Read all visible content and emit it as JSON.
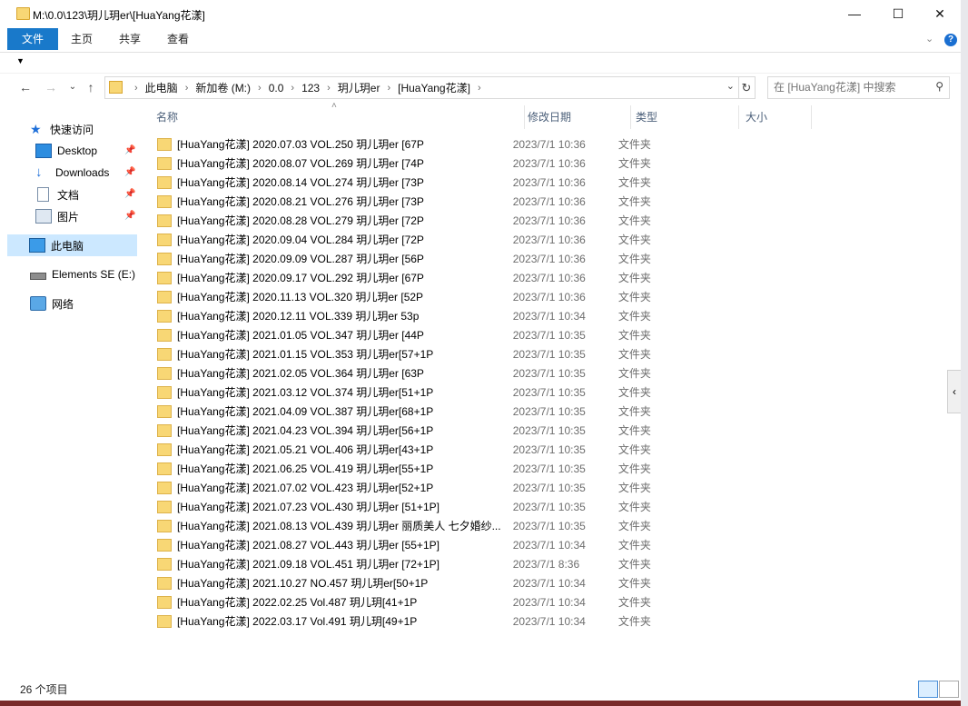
{
  "window": {
    "title": "M:\\0.0\\123\\玥儿玥er\\[HuaYang花漾]"
  },
  "ribbon": {
    "tabs": [
      "文件",
      "主页",
      "共享",
      "查看"
    ]
  },
  "address": {
    "crumbs": [
      "此电脑",
      "新加卷 (M:)",
      "0.0",
      "123",
      "玥儿玥er",
      "[HuaYang花漾]"
    ],
    "search_placeholder": "在 [HuaYang花漾] 中搜索"
  },
  "sidebar": {
    "items": [
      {
        "label": "快速访问",
        "icon": "star-icon"
      },
      {
        "label": "Desktop",
        "icon": "desktop-icon"
      },
      {
        "label": "Downloads",
        "icon": "download-icon"
      },
      {
        "label": "文档",
        "icon": "document-icon"
      },
      {
        "label": "图片",
        "icon": "picture-icon"
      },
      {
        "label": "此电脑",
        "icon": "computer-icon"
      },
      {
        "label": "Elements SE (E:)",
        "icon": "drive-icon"
      },
      {
        "label": "网络",
        "icon": "network-icon"
      }
    ]
  },
  "columns": {
    "name": "名称",
    "date": "修改日期",
    "type": "类型",
    "size": "大小"
  },
  "files": [
    {
      "name": "[HuaYang花漾] 2020.07.03 VOL.250 玥儿玥er [67P",
      "date": "2023/7/1 10:36",
      "type": "文件夹"
    },
    {
      "name": "[HuaYang花漾] 2020.08.07 VOL.269 玥儿玥er [74P",
      "date": "2023/7/1 10:36",
      "type": "文件夹"
    },
    {
      "name": "[HuaYang花漾] 2020.08.14 VOL.274 玥儿玥er [73P",
      "date": "2023/7/1 10:36",
      "type": "文件夹"
    },
    {
      "name": "[HuaYang花漾] 2020.08.21 VOL.276 玥儿玥er [73P",
      "date": "2023/7/1 10:36",
      "type": "文件夹"
    },
    {
      "name": "[HuaYang花漾] 2020.08.28 VOL.279 玥儿玥er [72P",
      "date": "2023/7/1 10:36",
      "type": "文件夹"
    },
    {
      "name": "[HuaYang花漾] 2020.09.04 VOL.284 玥儿玥er [72P",
      "date": "2023/7/1 10:36",
      "type": "文件夹"
    },
    {
      "name": "[HuaYang花漾] 2020.09.09 VOL.287 玥儿玥er [56P",
      "date": "2023/7/1 10:36",
      "type": "文件夹"
    },
    {
      "name": "[HuaYang花漾] 2020.09.17 VOL.292 玥儿玥er [67P",
      "date": "2023/7/1 10:36",
      "type": "文件夹"
    },
    {
      "name": "[HuaYang花漾] 2020.11.13 VOL.320 玥儿玥er [52P",
      "date": "2023/7/1 10:36",
      "type": "文件夹"
    },
    {
      "name": "[HuaYang花漾] 2020.12.11 VOL.339 玥儿玥er 53p",
      "date": "2023/7/1 10:34",
      "type": "文件夹"
    },
    {
      "name": "[HuaYang花漾] 2021.01.05 VOL.347 玥儿玥er [44P",
      "date": "2023/7/1 10:35",
      "type": "文件夹"
    },
    {
      "name": "[HuaYang花漾] 2021.01.15 VOL.353 玥儿玥er[57+1P",
      "date": "2023/7/1 10:35",
      "type": "文件夹"
    },
    {
      "name": "[HuaYang花漾] 2021.02.05 VOL.364 玥儿玥er [63P",
      "date": "2023/7/1 10:35",
      "type": "文件夹"
    },
    {
      "name": "[HuaYang花漾] 2021.03.12 VOL.374 玥儿玥er[51+1P",
      "date": "2023/7/1 10:35",
      "type": "文件夹"
    },
    {
      "name": "[HuaYang花漾] 2021.04.09 VOL.387 玥儿玥er[68+1P",
      "date": "2023/7/1 10:35",
      "type": "文件夹"
    },
    {
      "name": "[HuaYang花漾] 2021.04.23 VOL.394 玥儿玥er[56+1P",
      "date": "2023/7/1 10:35",
      "type": "文件夹"
    },
    {
      "name": "[HuaYang花漾] 2021.05.21 VOL.406 玥儿玥er[43+1P",
      "date": "2023/7/1 10:35",
      "type": "文件夹"
    },
    {
      "name": "[HuaYang花漾] 2021.06.25 VOL.419 玥儿玥er[55+1P",
      "date": "2023/7/1 10:35",
      "type": "文件夹"
    },
    {
      "name": "[HuaYang花漾] 2021.07.02 VOL.423 玥儿玥er[52+1P",
      "date": "2023/7/1 10:35",
      "type": "文件夹"
    },
    {
      "name": "[HuaYang花漾] 2021.07.23 VOL.430 玥儿玥er [51+1P]",
      "date": "2023/7/1 10:35",
      "type": "文件夹"
    },
    {
      "name": "[HuaYang花漾] 2021.08.13 VOL.439 玥儿玥er 丽质美人 七夕婚纱...",
      "date": "2023/7/1 10:35",
      "type": "文件夹"
    },
    {
      "name": "[HuaYang花漾] 2021.08.27 VOL.443 玥儿玥er [55+1P]",
      "date": "2023/7/1 10:34",
      "type": "文件夹"
    },
    {
      "name": "[HuaYang花漾] 2021.09.18 VOL.451 玥儿玥er [72+1P]",
      "date": "2023/7/1 8:36",
      "type": "文件夹"
    },
    {
      "name": "[HuaYang花漾] 2021.10.27 NO.457 玥儿玥er[50+1P",
      "date": "2023/7/1 10:34",
      "type": "文件夹"
    },
    {
      "name": "[HuaYang花漾] 2022.02.25 Vol.487 玥儿玥[41+1P",
      "date": "2023/7/1 10:34",
      "type": "文件夹"
    },
    {
      "name": "[HuaYang花漾] 2022.03.17 Vol.491 玥儿玥[49+1P",
      "date": "2023/7/1 10:34",
      "type": "文件夹"
    }
  ],
  "status": {
    "count": "26 个项目"
  }
}
